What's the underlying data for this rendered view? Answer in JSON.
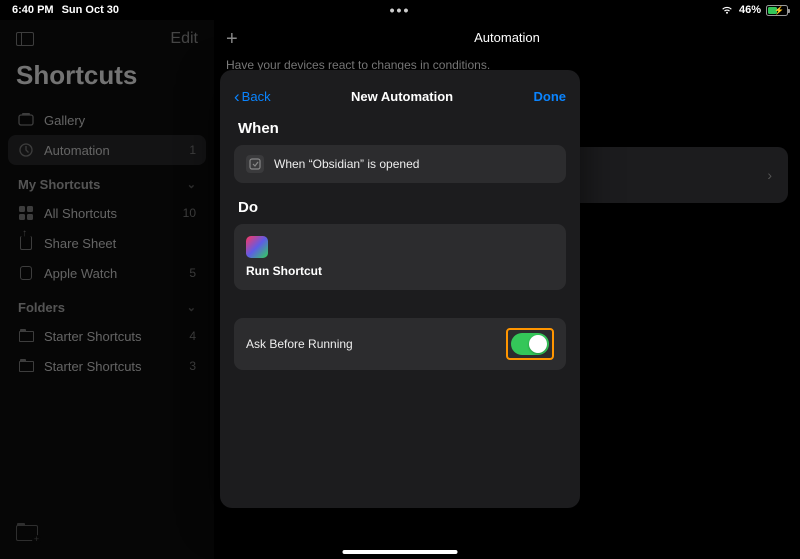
{
  "status": {
    "time": "6:40 PM",
    "date": "Sun Oct 30",
    "battery_pct": "46%",
    "battery_level": 46
  },
  "sidebar": {
    "edit": "Edit",
    "title": "Shortcuts",
    "gallery": "Gallery",
    "automation": {
      "label": "Automation",
      "count": "1"
    },
    "my_header": "My Shortcuts",
    "all": {
      "label": "All Shortcuts",
      "count": "10"
    },
    "share": "Share Sheet",
    "watch": {
      "label": "Apple Watch",
      "count": "5"
    },
    "folders_header": "Folders",
    "folders": [
      {
        "label": "Starter Shortcuts",
        "count": "4"
      },
      {
        "label": "Starter Shortcuts",
        "count": "3"
      }
    ]
  },
  "content": {
    "title": "Automation",
    "subtitle": "Have your devices react to changes in conditions."
  },
  "modal": {
    "back": "Back",
    "title": "New Automation",
    "done": "Done",
    "when_header": "When",
    "when_text": "When “Obsidian” is opened",
    "do_header": "Do",
    "do_text": "Run Shortcut",
    "ask_label": "Ask Before Running",
    "ask_value": true
  }
}
